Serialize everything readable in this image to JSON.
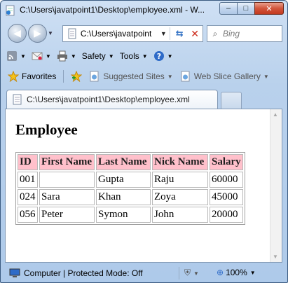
{
  "window": {
    "title": "C:\\Users\\javatpoint1\\Desktop\\employee.xml - W...",
    "controls": {
      "minimize": "–",
      "maximize": "□",
      "close": "✕"
    }
  },
  "nav": {
    "address": "C:\\Users\\javatpoint",
    "search_placeholder": "Bing"
  },
  "command_bar": {
    "items": [
      {
        "label": "Safety"
      },
      {
        "label": "Tools"
      }
    ]
  },
  "favorites_bar": {
    "favorites_label": "Favorites",
    "items": [
      {
        "label": "Suggested Sites"
      },
      {
        "label": "Web Slice Gallery"
      }
    ]
  },
  "tab": {
    "label": "C:\\Users\\javatpoint1\\Desktop\\employee.xml"
  },
  "page": {
    "heading": "Employee",
    "table": {
      "headers": [
        "ID",
        "First Name",
        "Last Name",
        "Nick Name",
        "Salary"
      ],
      "rows": [
        [
          "001",
          "",
          "Gupta",
          "Raju",
          "60000"
        ],
        [
          "024",
          "Sara",
          "Khan",
          "Zoya",
          "45000"
        ],
        [
          "056",
          "Peter",
          "Symon",
          "John",
          "20000"
        ]
      ]
    }
  },
  "status": {
    "zone": "Computer | Protected Mode: Off",
    "zoom": "100%"
  },
  "colors": {
    "header_bg": "#ffc0cb",
    "chrome_bg": "#b9d1ec",
    "close_button": "#c43a1f"
  }
}
